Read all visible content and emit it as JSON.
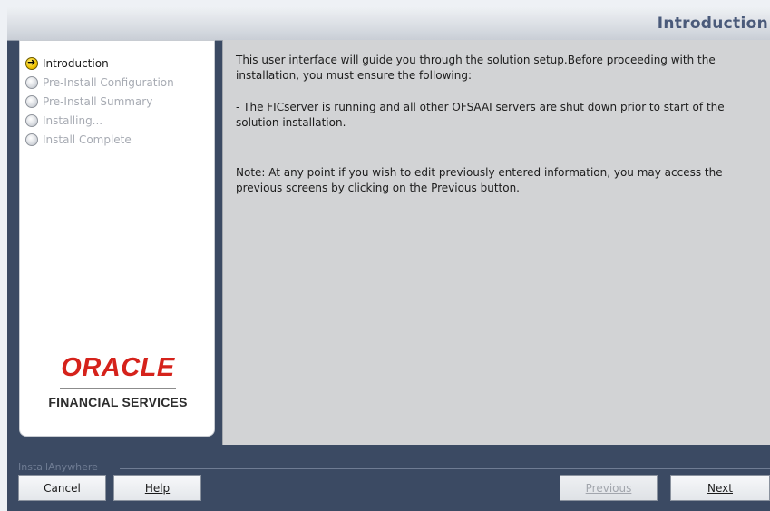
{
  "window": {
    "title": "Introduction"
  },
  "steps": [
    {
      "label": "Introduction",
      "state": "active"
    },
    {
      "label": "Pre-Install Configuration",
      "state": "pending"
    },
    {
      "label": "Pre-Install Summary",
      "state": "pending"
    },
    {
      "label": "Installing...",
      "state": "pending"
    },
    {
      "label": "Install Complete",
      "state": "pending"
    }
  ],
  "logo": {
    "brand": "ORACLE",
    "subtitle": "FINANCIAL SERVICES"
  },
  "content": {
    "paragraph1": "This user interface will guide you through the solution setup.Before proceeding with the installation, you must ensure the following:",
    "paragraph2": "- The FICserver is running and all other OFSAAI servers are shut down prior to start of the solution installation.",
    "paragraph3": "Note: At any point if you wish to edit previously entered information, you may access the previous screens by clicking on the Previous button."
  },
  "footer": {
    "installer_label": "InstallAnywhere",
    "cancel_label": "Cancel",
    "help_label": "Help",
    "previous_label": "Previous",
    "next_label": "Next"
  },
  "colors": {
    "accent_title": "#4a5a7a",
    "oracle_red": "#d5221b",
    "frame": "#3b4a63"
  },
  "icons": {
    "active_step": "arrow-circle-icon",
    "pending_step": "radio-circle-icon"
  }
}
